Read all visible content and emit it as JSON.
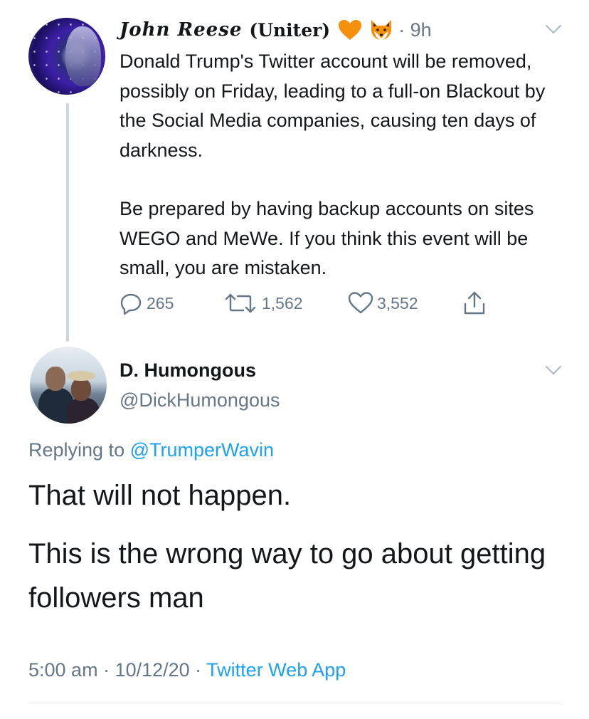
{
  "parent_tweet": {
    "author_script": "John Reese",
    "author_suffix": "(Uniter)",
    "emojis": [
      "orange-heart-icon",
      "fox-icon"
    ],
    "time": "· 9h",
    "text_paragraph_1": "Donald Trump's Twitter account will be removed, possibly on Friday, leading to a full-on Blackout by the Social Media companies, causing ten days of darkness.",
    "text_paragraph_2": "Be prepared by having backup accounts on sites WEGO and MeWe. If you think this event will be small, you are mistaken.",
    "replies": "265",
    "retweets": "1,562",
    "likes": "3,552"
  },
  "reply_tweet": {
    "display_name": "D. Humongous",
    "handle": "@DickHumongous",
    "replying_prefix": "Replying to",
    "replying_to": "@TrumperWavin",
    "text_paragraph_1": "That will not happen.",
    "text_paragraph_2": "This is the wrong way to go about getting followers man",
    "timestamp": "5:00 am · 10/12/20 ·",
    "source_app": "Twitter Web App"
  },
  "colors": {
    "text_primary": "#14171a",
    "text_secondary": "#657786",
    "link": "#1da1f2",
    "thread_line": "#ccd6dd",
    "heart_orange": "#f4900c"
  }
}
